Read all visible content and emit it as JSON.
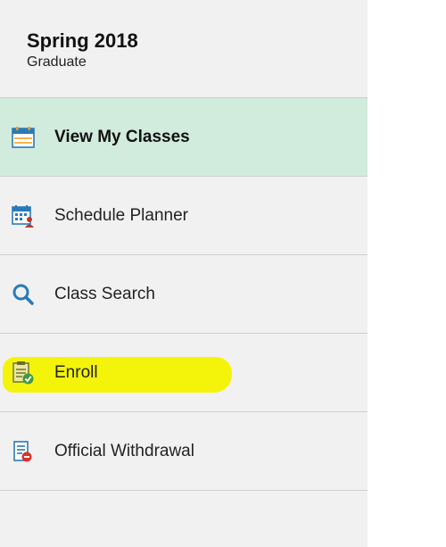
{
  "term": {
    "title": "Spring 2018",
    "career": "Graduate"
  },
  "nav": {
    "items": [
      {
        "label": "View My Classes",
        "icon": "calendar-icon",
        "active": true
      },
      {
        "label": "Schedule Planner",
        "icon": "schedule-planner-icon",
        "active": false
      },
      {
        "label": "Class Search",
        "icon": "search-icon",
        "active": false
      },
      {
        "label": "Enroll",
        "icon": "enroll-clipboard-check-icon",
        "active": false,
        "highlighted": true
      },
      {
        "label": "Official Withdrawal",
        "icon": "withdrawal-form-icon",
        "active": false
      }
    ]
  },
  "colors": {
    "panel_background": "#f1f1f1",
    "active_item_background": "#d1ebdd",
    "highlight_marker": "#f4f40a",
    "icon_blue": "#2a7ab8",
    "icon_green": "#3e9b3e",
    "icon_red": "#d9342b"
  }
}
